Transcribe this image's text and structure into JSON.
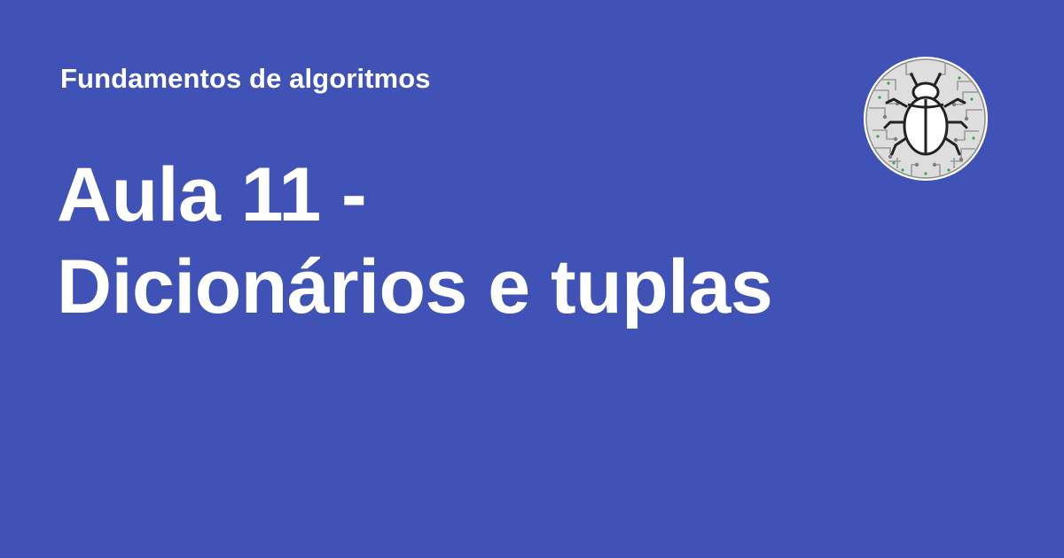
{
  "header": {
    "course": "Fundamentos de algoritmos"
  },
  "title": {
    "line1": "Aula 11 -",
    "line2": "Dicionários e tuplas"
  },
  "logo": {
    "icon": "bug-circuit-icon"
  },
  "colors": {
    "background": "#4052b5",
    "text": "#ffffff",
    "logo_fill": "#d9d9d9",
    "logo_circuit": "#9e9e9e",
    "logo_accent": "#3fa34d"
  }
}
